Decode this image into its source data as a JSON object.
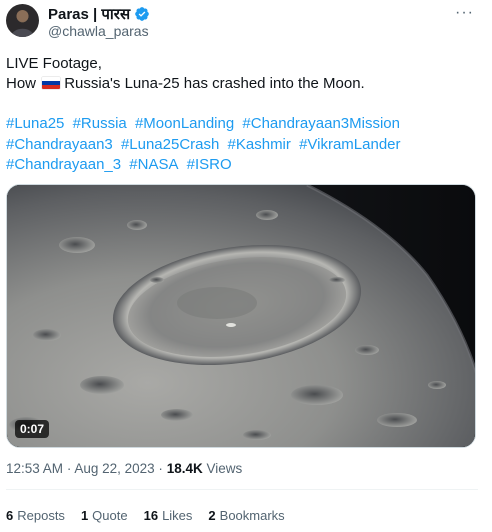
{
  "author": {
    "display_name": "Paras | पारस",
    "handle": "@chawla_paras",
    "verified_icon": "verified-badge-icon",
    "more_label": "···"
  },
  "tweet": {
    "line1": "LIVE Footage,",
    "line2_prefix": "How",
    "line2_suffix": "Russia's Luna-25 has crashed into the Moon.",
    "flag_icon": "russia-flag-icon",
    "hashtags": [
      "#Luna25",
      "#Russia",
      "#MoonLanding",
      "#Chandrayaan3Mission",
      "#Chandrayaan3",
      "#Luna25Crash",
      "#Kashmir",
      "#VikramLander",
      "#Chandrayaan_3",
      "#NASA",
      "#ISRO"
    ]
  },
  "media": {
    "timecode": "0:07"
  },
  "meta": {
    "time": "12:53 AM",
    "date": "Aug 22, 2023",
    "separator": "·",
    "views_count": "18.4K",
    "views_label": "Views"
  },
  "stats": {
    "reposts_count": "6",
    "reposts_label": "Reposts",
    "quotes_count": "1",
    "quotes_label": "Quote",
    "likes_count": "16",
    "likes_label": "Likes",
    "bookmarks_count": "2",
    "bookmarks_label": "Bookmarks"
  },
  "colors": {
    "link": "#1d9bf0",
    "secondary_text": "#536471",
    "primary_text": "#0f1419"
  }
}
